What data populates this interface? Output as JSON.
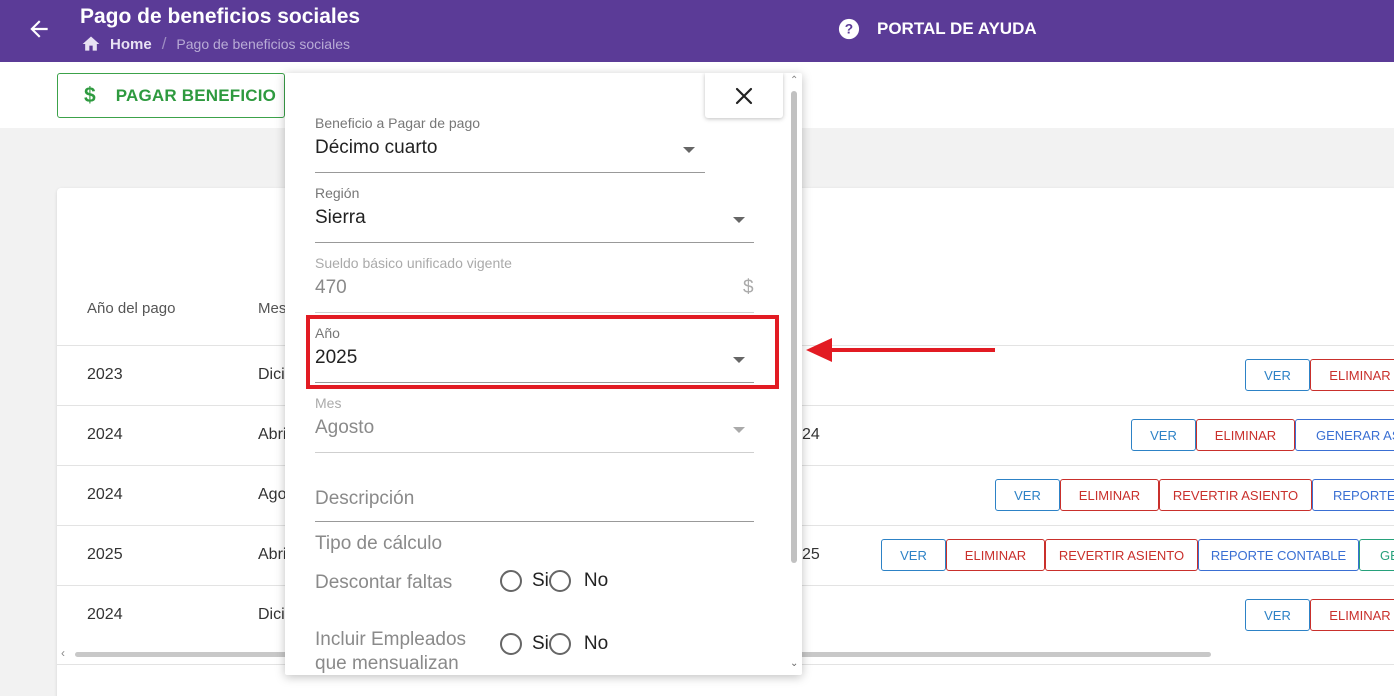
{
  "header": {
    "title": "Pago de beneficios sociales",
    "breadcrumb": {
      "home": "Home",
      "separator": "/",
      "current": "Pago de beneficios sociales"
    },
    "help_label": "PORTAL DE AYUDA",
    "bg_color": "#5b3b97"
  },
  "toolbar": {
    "pay_icon": "$",
    "pay_label": "PAGAR BENEFICIO",
    "pay_color": "#2e9a3f"
  },
  "table": {
    "headers": [
      "Año del pago",
      "Mes"
    ],
    "rows": [
      {
        "year": "2023",
        "month": "Dici",
        "extra": "",
        "actions": [
          "VER",
          "ELIMINAR"
        ]
      },
      {
        "year": "2024",
        "month": "Abri",
        "extra": "24",
        "actions": [
          "VER",
          "ELIMINAR",
          "GENERAR ASI"
        ]
      },
      {
        "year": "2024",
        "month": "Ago",
        "extra": "",
        "actions": [
          "VER",
          "ELIMINAR",
          "REVERTIR ASIENTO",
          "REPORTE C"
        ]
      },
      {
        "year": "2025",
        "month": "Abri",
        "extra": "25",
        "actions": [
          "VER",
          "ELIMINAR",
          "REVERTIR ASIENTO",
          "REPORTE CONTABLE",
          "GE"
        ]
      },
      {
        "year": "2024",
        "month": "Dici",
        "extra": "",
        "actions": [
          "VER",
          "ELIMINAR"
        ]
      }
    ]
  },
  "modal": {
    "close_icon": "close-icon",
    "fields": {
      "beneficio": {
        "label": "Beneficio a Pagar de pago",
        "value": "Décimo cuarto"
      },
      "region": {
        "label": "Región",
        "value": "Sierra"
      },
      "sueldo": {
        "label": "Sueldo básico unificado vigente",
        "value": "470",
        "suffix": "$"
      },
      "anio": {
        "label": "Año",
        "value": "2025"
      },
      "mes": {
        "label": "Mes",
        "value": "Agosto"
      }
    },
    "descripcion_label": "Descripción",
    "tipo_calculo_label": "Tipo de cálculo",
    "descontar_faltas": {
      "label": "Descontar faltas",
      "options": [
        "Si",
        "No"
      ]
    },
    "incluir_empleados": {
      "label_line1": "Incluir Empleados",
      "label_line2": "que mensualizan",
      "options": [
        "Si",
        "No"
      ]
    }
  },
  "annotation_color": "#e21b23"
}
